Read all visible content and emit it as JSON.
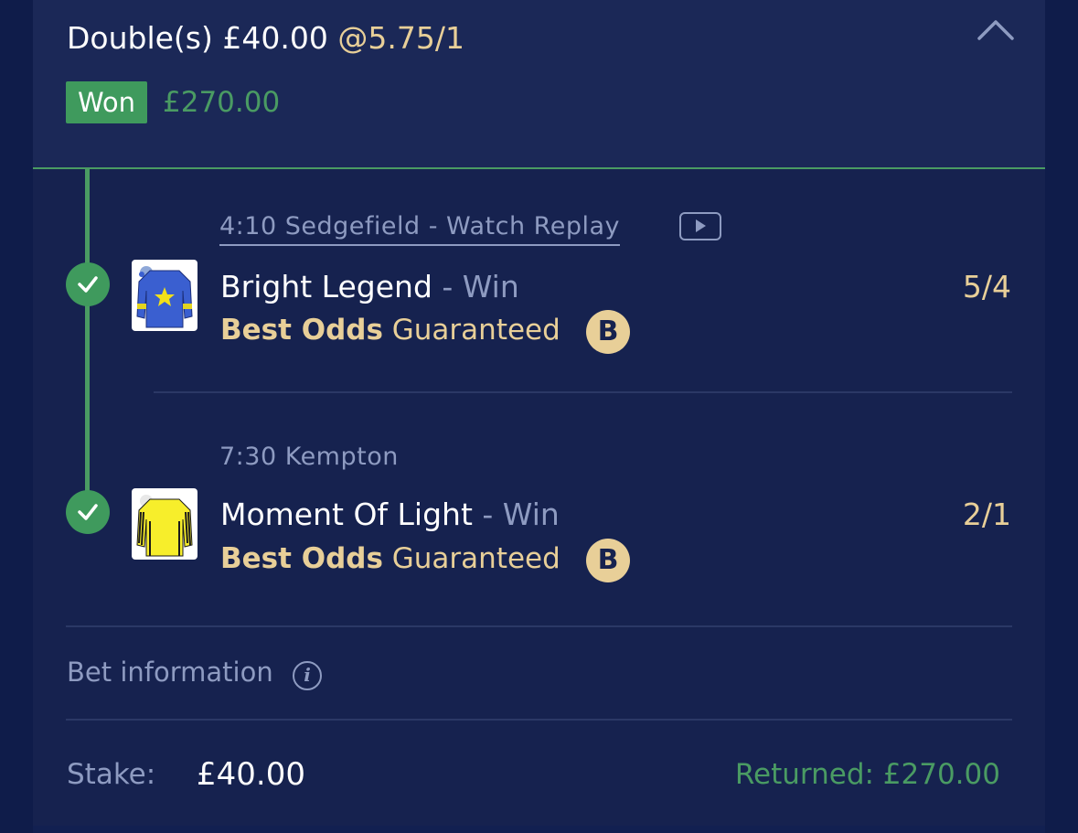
{
  "header": {
    "bet_type_stake": "Double(s) £40.00",
    "odds": "@5.75/1",
    "status_badge": "Won",
    "won_amount": "£270.00"
  },
  "legs": [
    {
      "race": "4:10 Sedgefield - Watch Replay",
      "selection": "Bright Legend",
      "market": " - Win",
      "promo_bold": "Best Odds",
      "promo_rest": " Guaranteed",
      "promo_icon_letter": "B",
      "price": "5/4",
      "result_icon": "check-icon",
      "silk_colors": {
        "body": "#3a5fd0",
        "star": "#f2e01a",
        "armband": "#e3d41f"
      }
    },
    {
      "race": "7:30 Kempton",
      "selection": "Moment Of Light",
      "market": " - Win",
      "promo_bold": "Best Odds",
      "promo_rest": " Guaranteed",
      "promo_icon_letter": "B",
      "price": "2/1",
      "result_icon": "check-icon",
      "silk_colors": {
        "body": "#f7ee2b",
        "stripe": "#1a1a1a"
      }
    }
  ],
  "bet_info": {
    "label": "Bet information"
  },
  "footer": {
    "stake_label": "Stake:",
    "stake_value": "£40.00",
    "returned": "Returned: £270.00"
  },
  "colors": {
    "background": "#16224f",
    "header_bg": "#1b2857",
    "accent_green": "#4a9b63",
    "gold": "#e8cf98",
    "muted": "#8e9bc1"
  }
}
